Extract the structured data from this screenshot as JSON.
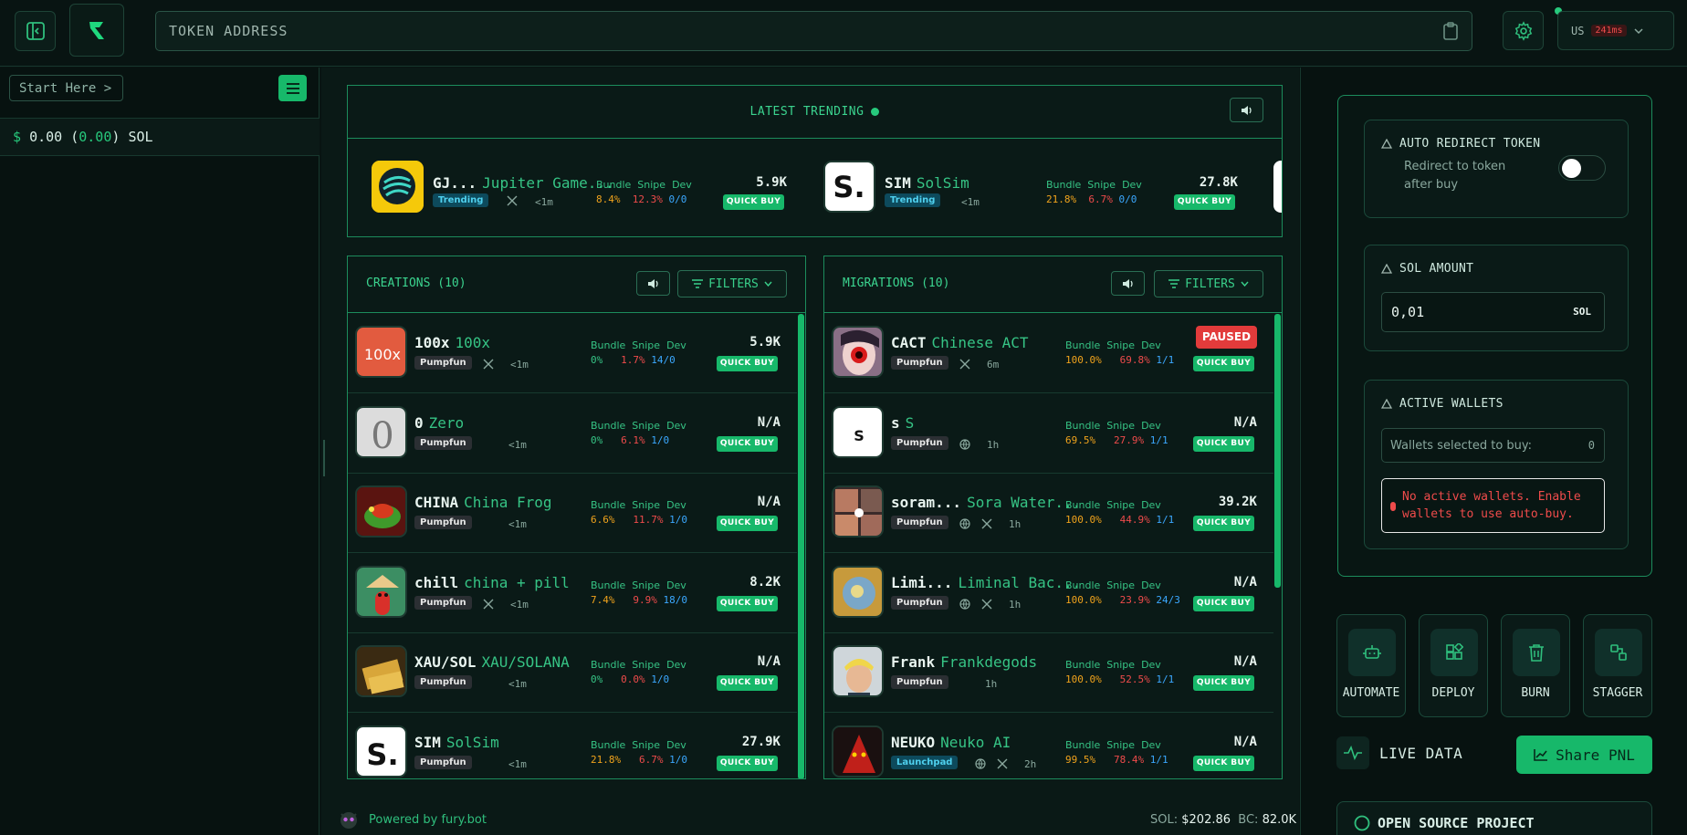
{
  "topbar": {
    "token_placeholder": "TOKEN ADDRESS",
    "region": "US",
    "latency": "241ms"
  },
  "left": {
    "start_label": "Start Here >",
    "balance": {
      "symbol": "$",
      "amount": "0.00",
      "change": "0.00",
      "unit": "SOL"
    }
  },
  "trending": {
    "title": "LATEST TRENDING",
    "items": [
      {
        "ticker": "GJ...",
        "name": "Jupiter Game...",
        "badge": "Trending",
        "age": "<1m",
        "bundle": "8.4%",
        "snipe": "12.3%",
        "dev": "0/0",
        "mc": "5.9K"
      },
      {
        "ticker": "SIM",
        "name": "SolSim",
        "badge": "Trending",
        "age": "<1m",
        "bundle": "21.8%",
        "snipe": "6.7%",
        "dev": "0/0",
        "mc": "27.8K"
      }
    ]
  },
  "labels": {
    "bundle": "Bundle",
    "snipe": "Snipe",
    "dev": "Dev",
    "quick_buy": "QUICK BUY",
    "filters": "FILTERS",
    "paused": "PAUSED"
  },
  "creations": {
    "title": "CREATIONS (10)",
    "items": [
      {
        "ticker": "100x",
        "name": "100x",
        "badge": "Pumpfun",
        "age": "<1m",
        "x": true,
        "web": false,
        "bundle": "0%",
        "snipe": "1.7%",
        "dev": "14/0",
        "mc": "5.9K",
        "logo": "100x"
      },
      {
        "ticker": "0",
        "name": "Zero",
        "badge": "Pumpfun",
        "age": "<1m",
        "x": false,
        "web": false,
        "bundle": "0%",
        "snipe": "6.1%",
        "dev": "1/0",
        "mc": "N/A",
        "logo": "0"
      },
      {
        "ticker": "CHINA",
        "name": "China Frog",
        "badge": "Pumpfun",
        "age": "<1m",
        "x": false,
        "web": false,
        "bundle": "6.6%",
        "snipe": "11.7%",
        "dev": "1/0",
        "mc": "N/A",
        "logo": ""
      },
      {
        "ticker": "chill",
        "name": "china + pill",
        "badge": "Pumpfun",
        "age": "<1m",
        "x": true,
        "web": false,
        "bundle": "7.4%",
        "snipe": "9.9%",
        "dev": "18/0",
        "mc": "8.2K",
        "logo": ""
      },
      {
        "ticker": "XAU/SOL",
        "name": "XAU/SOLANA",
        "badge": "Pumpfun",
        "age": "<1m",
        "x": false,
        "web": false,
        "bundle": "0%",
        "snipe": "0.0%",
        "dev": "1/0",
        "mc": "N/A",
        "logo": ""
      },
      {
        "ticker": "SIM",
        "name": "SolSim",
        "badge": "Pumpfun",
        "age": "<1m",
        "x": false,
        "web": false,
        "bundle": "21.8%",
        "snipe": "6.7%",
        "dev": "1/0",
        "mc": "27.9K",
        "logo": "S."
      }
    ]
  },
  "migrations": {
    "title": "MIGRATIONS (10)",
    "items": [
      {
        "ticker": "CACT",
        "name": "Chinese ACT",
        "badge": "Pumpfun",
        "age": "6m",
        "x": true,
        "web": false,
        "bundle": "100.0%",
        "snipe": "69.8%",
        "dev": "1/1",
        "mc": "",
        "paused": true,
        "logo": ""
      },
      {
        "ticker": "s",
        "name": "S",
        "badge": "Pumpfun",
        "age": "1h",
        "x": false,
        "web": true,
        "bundle": "69.5%",
        "snipe": "27.9%",
        "dev": "1/1",
        "mc": "N/A",
        "paused": false,
        "logo": "S"
      },
      {
        "ticker": "soram...",
        "name": "Sora Water...",
        "badge": "Pumpfun",
        "age": "1h",
        "x": true,
        "web": true,
        "bundle": "100.0%",
        "snipe": "44.9%",
        "dev": "1/1",
        "mc": "39.2K",
        "paused": false,
        "logo": ""
      },
      {
        "ticker": "Limi...",
        "name": "Liminal Bac...",
        "badge": "Pumpfun",
        "age": "1h",
        "x": true,
        "web": true,
        "bundle": "100.0%",
        "snipe": "23.9%",
        "dev": "24/3",
        "mc": "N/A",
        "paused": false,
        "logo": ""
      },
      {
        "ticker": "Frank",
        "name": "Frankdegods",
        "badge": "Pumpfun",
        "age": "1h",
        "x": false,
        "web": false,
        "bundle": "100.0%",
        "snipe": "52.5%",
        "dev": "1/1",
        "mc": "N/A",
        "paused": false,
        "logo": ""
      },
      {
        "ticker": "NEUKO",
        "name": "Neuko AI",
        "badge": "Launchpad",
        "age": "2h",
        "x": true,
        "web": true,
        "bundle": "99.5%",
        "snipe": "78.4%",
        "dev": "1/1",
        "mc": "N/A",
        "paused": false,
        "logo": ""
      }
    ]
  },
  "footer": {
    "powered": "Powered by fury.bot",
    "sol_label": "SOL:",
    "sol_price": "$202.86",
    "bc_label": "BC:",
    "bc_value": "82.0K"
  },
  "right": {
    "auto_redirect": {
      "title": "AUTO REDIRECT TOKEN",
      "desc": "Redirect to token after buy",
      "enabled": false
    },
    "sol_amount": {
      "title": "SOL AMOUNT",
      "value": "0,01",
      "unit": "SOL"
    },
    "active_wallets": {
      "title": "ACTIVE WALLETS",
      "selected_label": "Wallets selected to buy:",
      "selected_count": "0",
      "warning": "No active wallets. Enable wallets to use auto-buy."
    },
    "actions": [
      "AUTOMATE",
      "DEPLOY",
      "BURN",
      "STAGGER"
    ],
    "live_data": "LIVE DATA",
    "share_pnl": "Share PNL",
    "open_source": "OPEN SOURCE PROJECT"
  },
  "colors": {
    "accent": "#17b86a",
    "bg": "#081412",
    "orange": "#f0a31c",
    "red": "#ef4b4b",
    "blue": "#3ba8ff"
  }
}
